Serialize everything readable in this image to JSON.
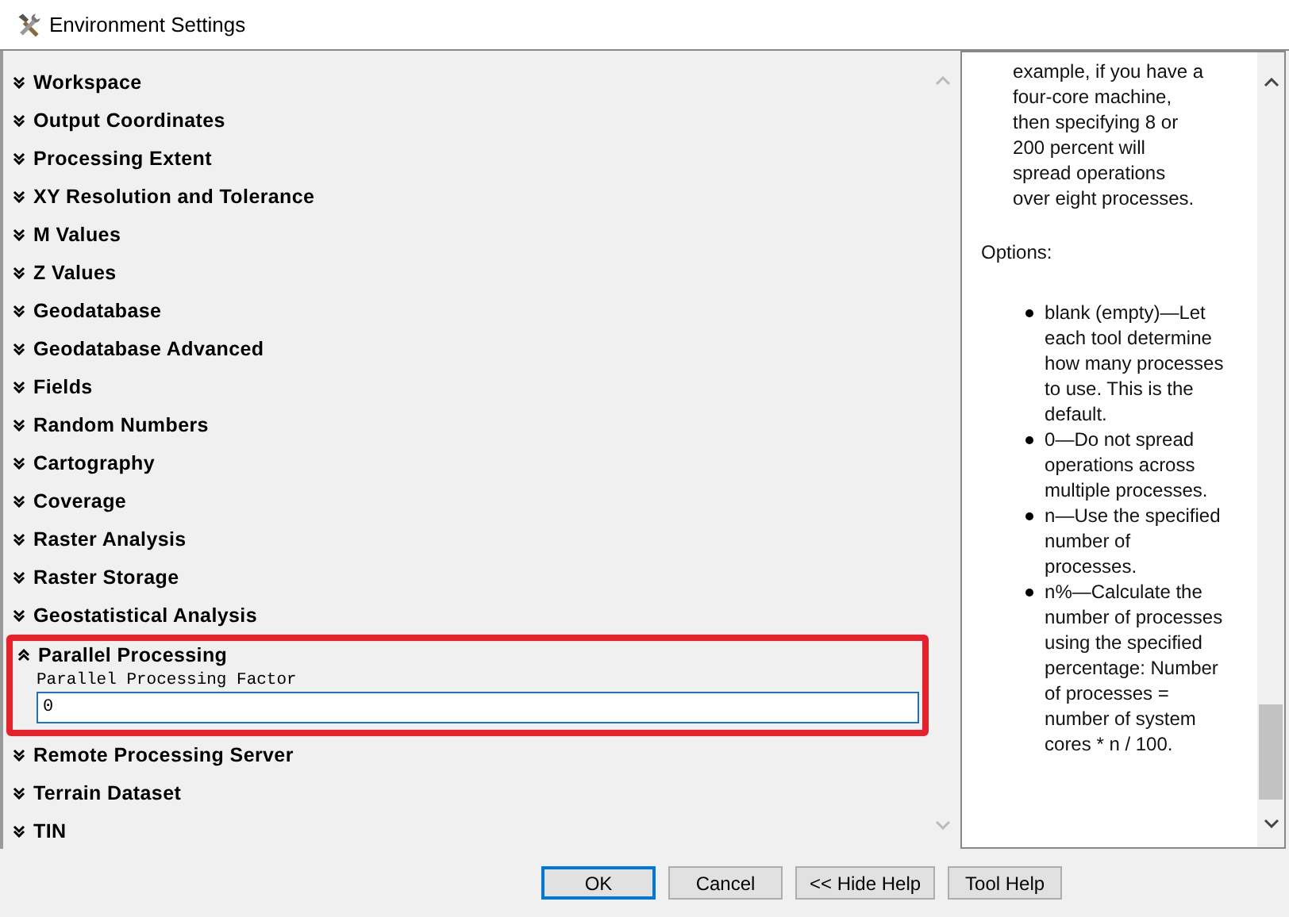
{
  "window": {
    "title": "Environment Settings"
  },
  "sections": [
    {
      "label": "Workspace",
      "expanded": false,
      "highlighted": false
    },
    {
      "label": "Output Coordinates",
      "expanded": false,
      "highlighted": false
    },
    {
      "label": "Processing Extent",
      "expanded": false,
      "highlighted": false
    },
    {
      "label": "XY Resolution and Tolerance",
      "expanded": false,
      "highlighted": false
    },
    {
      "label": "M Values",
      "expanded": false,
      "highlighted": false
    },
    {
      "label": "Z Values",
      "expanded": false,
      "highlighted": false
    },
    {
      "label": "Geodatabase",
      "expanded": false,
      "highlighted": false
    },
    {
      "label": "Geodatabase Advanced",
      "expanded": false,
      "highlighted": false
    },
    {
      "label": "Fields",
      "expanded": false,
      "highlighted": false
    },
    {
      "label": "Random Numbers",
      "expanded": false,
      "highlighted": false
    },
    {
      "label": "Cartography",
      "expanded": false,
      "highlighted": false
    },
    {
      "label": "Coverage",
      "expanded": false,
      "highlighted": false
    },
    {
      "label": "Raster Analysis",
      "expanded": false,
      "highlighted": false
    },
    {
      "label": "Raster Storage",
      "expanded": false,
      "highlighted": false
    },
    {
      "label": "Geostatistical Analysis",
      "expanded": false,
      "highlighted": false
    },
    {
      "label": "Parallel Processing",
      "expanded": true,
      "highlighted": true,
      "field": {
        "label": "Parallel Processing Factor",
        "value": "0"
      }
    },
    {
      "label": "Remote Processing Server",
      "expanded": false,
      "highlighted": false
    },
    {
      "label": "Terrain Dataset",
      "expanded": false,
      "highlighted": false
    },
    {
      "label": "TIN",
      "expanded": false,
      "highlighted": false
    }
  ],
  "help": {
    "paragraph": "example, if you have a four-core machine, then specifying 8 or 200 percent will spread operations over eight processes.",
    "options_heading": "Options:",
    "options": [
      "blank (empty)—Let each tool determine how many processes to use. This is the default.",
      "0—Do not spread operations across multiple processes.",
      "n—Use the specified number of processes.",
      "n%—Calculate the number of processes using the specified percentage: Number of processes = number of system cores * n / 100."
    ]
  },
  "buttons": [
    {
      "label": "OK",
      "default": true
    },
    {
      "label": "Cancel",
      "default": false
    },
    {
      "label": "<< Hide Help",
      "default": false
    },
    {
      "label": "Tool Help",
      "default": false
    }
  ]
}
